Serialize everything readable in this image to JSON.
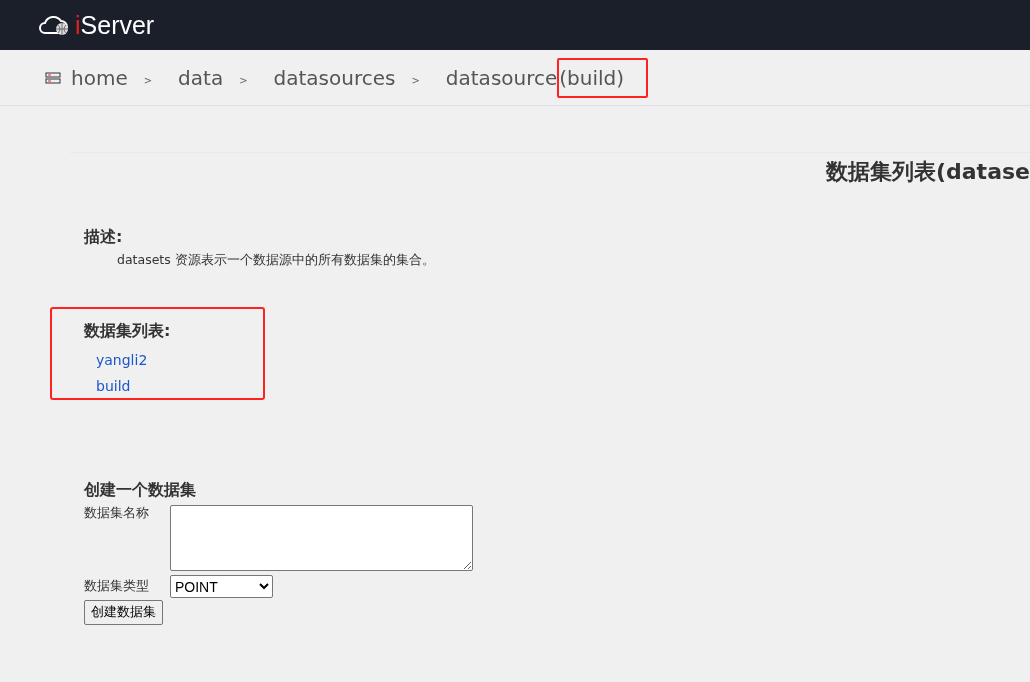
{
  "header": {
    "logo": {
      "prefix": "i",
      "name": "Server"
    }
  },
  "breadcrumb": [
    {
      "label": "home",
      "highlighted": false
    },
    {
      "label": "data",
      "highlighted": false
    },
    {
      "label": "datasources",
      "highlighted": false
    },
    {
      "label": "datasource",
      "suffix": "(build)",
      "highlighted": true
    }
  ],
  "breadcrumb_separator": ">",
  "page_title": "数据集列表(datase",
  "description": {
    "heading": "描述:",
    "text": "datasets 资源表示一个数据源中的所有数据集的集合。"
  },
  "dataset_list": {
    "heading": "数据集列表:",
    "highlighted": true,
    "items": [
      "yangli2",
      "build"
    ]
  },
  "create_form": {
    "heading": "创建一个数据集",
    "name_label": "数据集名称",
    "type_label": "数据集类型",
    "type_value": "POINT",
    "submit": "创建数据集"
  }
}
